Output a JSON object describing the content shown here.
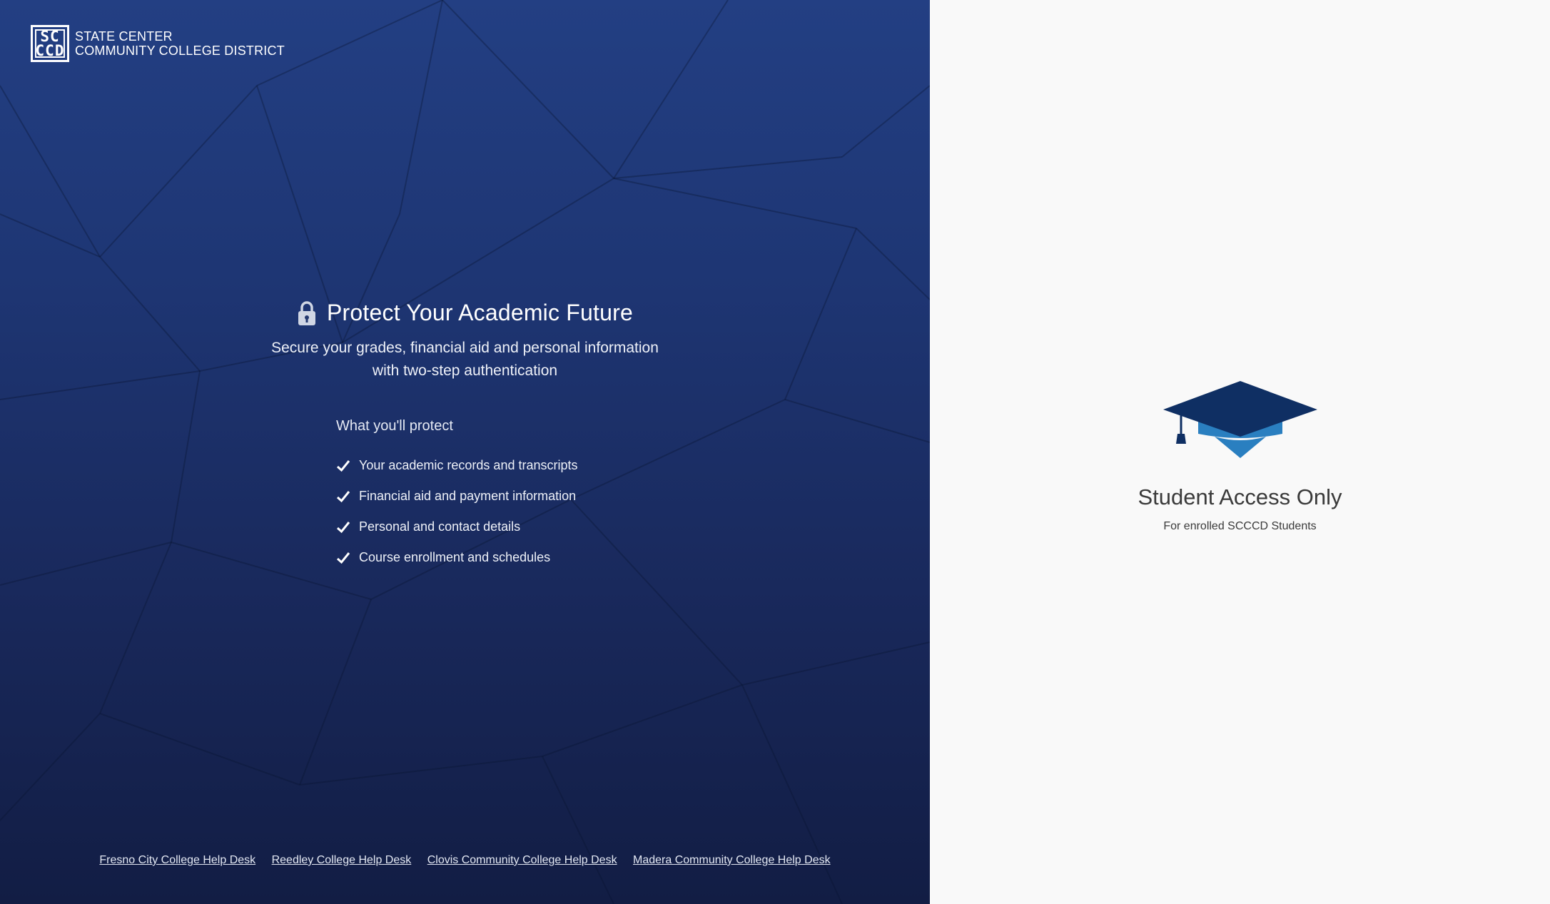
{
  "brand": {
    "logo_letters_top": "SC",
    "logo_letters_bottom": "CCD",
    "line1": "State Center",
    "line2": "Community College District"
  },
  "hero": {
    "title": "Protect Your Academic Future",
    "subtitle_line1": "Secure your grades, financial aid and personal information",
    "subtitle_line2": "with two-step authentication"
  },
  "protect": {
    "heading": "What you'll protect",
    "items": [
      "Your academic records and transcripts",
      "Financial aid and payment information",
      "Personal and contact details",
      "Course enrollment and schedules"
    ]
  },
  "footer": {
    "links": [
      "Fresno City College Help Desk",
      "Reedley College Help Desk",
      "Clovis Community College Help Desk",
      "Madera Community College Help Desk"
    ]
  },
  "access": {
    "title": "Student Access Only",
    "subtitle": "For enrolled SCCCD Students"
  },
  "colors": {
    "left_panel_top": "#233f83",
    "left_panel_bottom": "#121d44",
    "cap_dark": "#0f2f63",
    "cap_light": "#2a7fc0",
    "right_panel_bg": "#f9f9f9"
  },
  "icons": {
    "lock": "lock-icon",
    "check": "checkmark-icon",
    "cap": "graduation-cap-icon"
  }
}
